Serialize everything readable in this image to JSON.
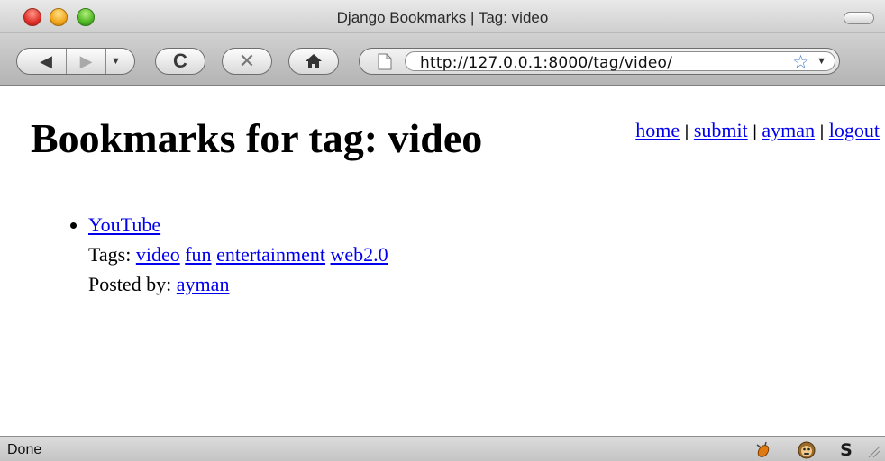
{
  "window": {
    "title": "Django Bookmarks | Tag: video"
  },
  "toolbar": {
    "back_glyph": "◀",
    "forward_glyph": "▶",
    "history_glyph": "▼",
    "reload_glyph": "C",
    "stop_glyph": "✕",
    "url": "http://127.0.0.1:8000/tag/video/",
    "bookmark_star_glyph": "☆",
    "url_dropdown_glyph": "▼"
  },
  "page": {
    "heading": "Bookmarks for tag: video",
    "nav": {
      "home": "home",
      "submit": "submit",
      "user": "ayman",
      "logout": "logout",
      "separator": "|"
    },
    "bookmarks": [
      {
        "title": "YouTube",
        "tags_label": "Tags:",
        "tags": [
          "video",
          "fun",
          "entertainment",
          "web2.0"
        ],
        "posted_by_label": "Posted by:",
        "user": "ayman"
      }
    ]
  },
  "status": {
    "text": "Done"
  },
  "icons": {
    "back": "back-arrow-icon",
    "forward": "forward-arrow-icon",
    "reload": "reload-icon",
    "stop": "stop-icon",
    "home": "home-icon",
    "page": "page-icon",
    "star": "star-icon",
    "extensions": [
      "firebug-icon",
      "greasemonkey-icon",
      "s-icon"
    ]
  },
  "colors": {
    "link": "#0000ee",
    "star": "#4d7fc9",
    "close": "#e0302a",
    "minimize": "#f2a61c",
    "zoom": "#4fb825"
  }
}
